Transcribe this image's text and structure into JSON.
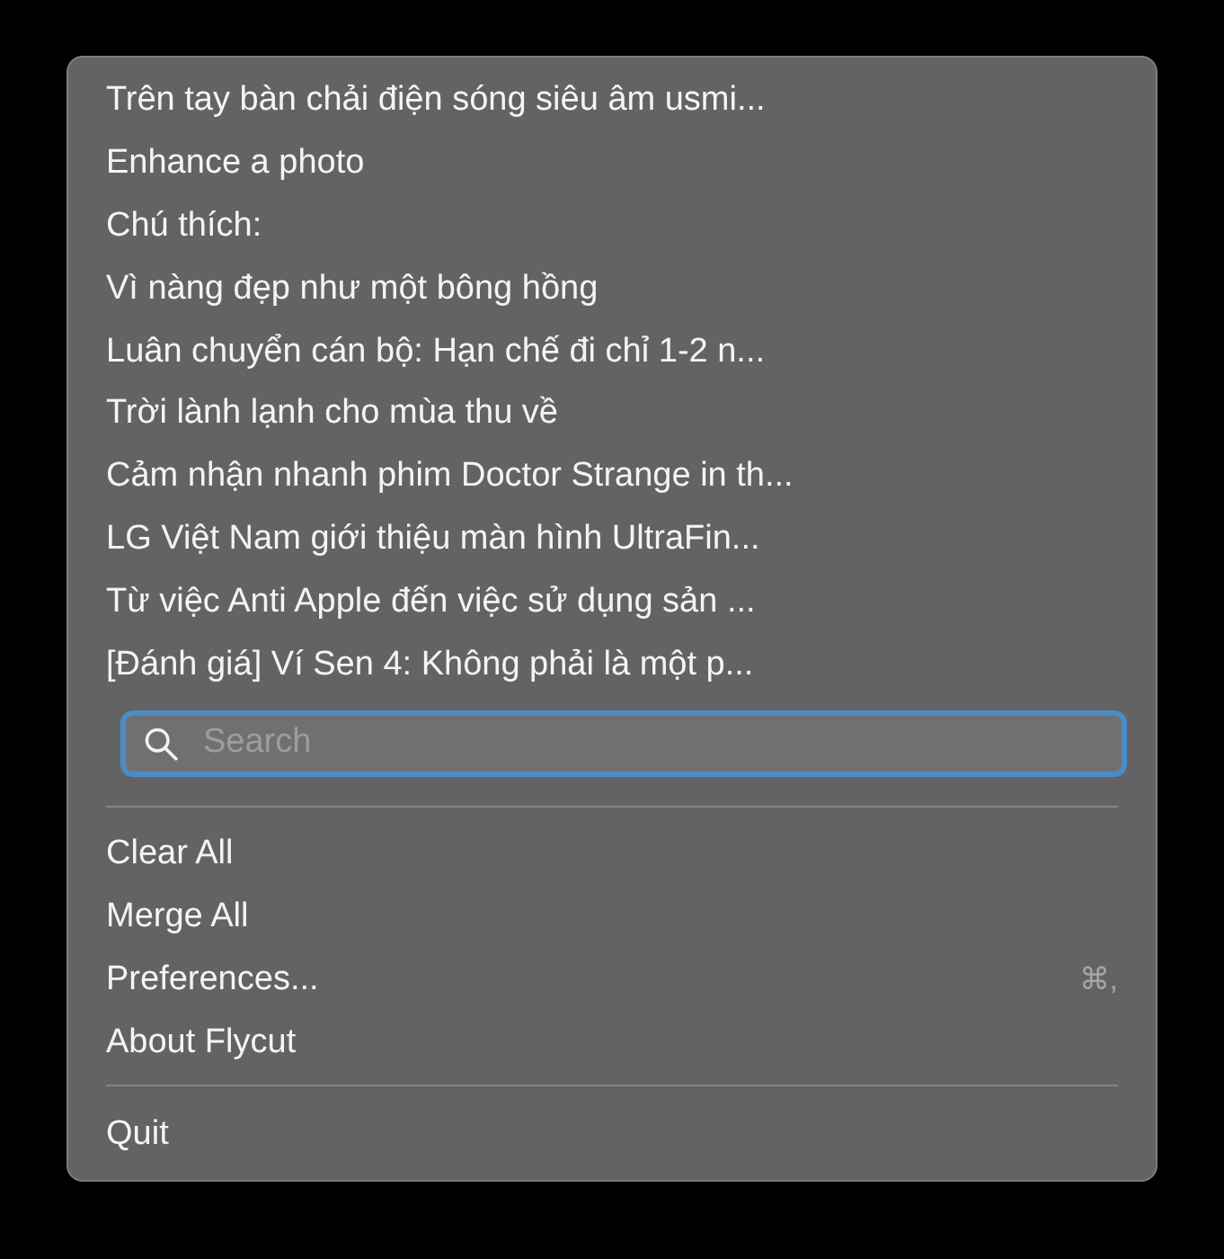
{
  "menu": {
    "history_items": [
      {
        "label": "Trên tay bàn chải điện sóng siêu âm usmi..."
      },
      {
        "label": "Enhance a photo"
      },
      {
        "label": "Chú thích:"
      },
      {
        "label": "Vì nàng đẹp như một bông hồng"
      },
      {
        "label": "Luân chuyển cán bộ: Hạn chế đi chỉ 1-2 n..."
      },
      {
        "label": "Trời lành lạnh cho mùa thu về"
      },
      {
        "label": "Cảm nhận nhanh phim Doctor Strange in th..."
      },
      {
        "label": "LG Việt Nam giới thiệu màn hình UltraFin..."
      },
      {
        "label": "Từ việc Anti Apple đến việc sử dụng sản ..."
      },
      {
        "label": "[Đánh giá] Ví Sen 4: Không phải là một p..."
      }
    ],
    "search": {
      "placeholder": "Search",
      "focused": true
    },
    "actions": [
      {
        "label": "Clear All"
      },
      {
        "label": "Merge All"
      },
      {
        "label": "Preferences...",
        "shortcut": "⌘,"
      },
      {
        "label": "About Flycut"
      }
    ],
    "footer_actions": [
      {
        "label": "Quit"
      }
    ]
  }
}
